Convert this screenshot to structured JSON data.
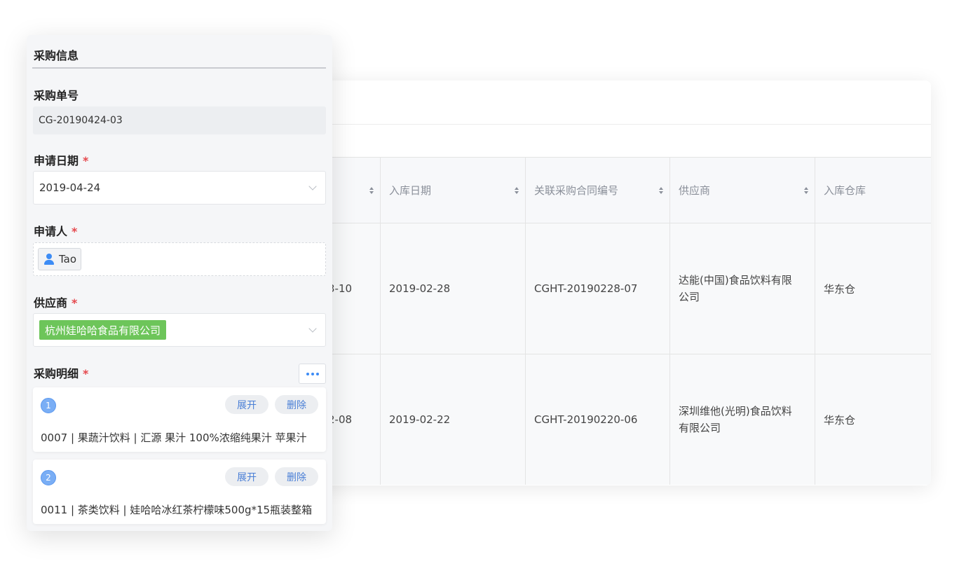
{
  "table": {
    "headers": [
      {
        "label": ""
      },
      {
        "label": "入库日期"
      },
      {
        "label": "关联采购合同编号"
      },
      {
        "label": "供应商"
      },
      {
        "label": "入库仓库"
      }
    ],
    "rows": [
      {
        "partial": "3-10",
        "date": "2019-02-28",
        "contract": "CGHT-20190228-07",
        "supplier": "达能(中国)食品饮料有限公司",
        "warehouse": "华东仓"
      },
      {
        "partial": "2-08",
        "date": "2019-02-22",
        "contract": "CGHT-20190220-06",
        "supplier": "深圳维他(光明)食品饮料有限公司",
        "warehouse": "华东仓"
      }
    ]
  },
  "form": {
    "title": "采购信息",
    "order_no": {
      "label": "采购单号",
      "value": "CG-20190424-03"
    },
    "apply_date": {
      "label": "申请日期",
      "required_mark": "*",
      "value": "2019-04-24"
    },
    "applicant": {
      "label": "申请人",
      "required_mark": "*",
      "value": "Tao"
    },
    "supplier": {
      "label": "供应商",
      "required_mark": "*",
      "value": "杭州娃哈哈食品有限公司"
    },
    "details": {
      "label": "采购明细",
      "required_mark": "*",
      "items": [
        {
          "index": "1",
          "expand": "展开",
          "delete": "删除",
          "desc": "0007 | 果蔬汁饮料 | 汇源 果汁 100%浓缩纯果汁 苹果汁"
        },
        {
          "index": "2",
          "expand": "展开",
          "delete": "删除",
          "desc": "0011 | 茶类饮料 | 娃哈哈冰红茶柠檬味500g*15瓶装整箱"
        }
      ]
    }
  },
  "colors": {
    "accent": "#3d8cf5",
    "tag_green": "#6dc55a",
    "required_red": "#e5484d"
  },
  "icons": {
    "sort": "sort-caret-icon",
    "chevron": "chevron-down-icon",
    "user": "user-icon",
    "more": "more-dots-icon"
  }
}
